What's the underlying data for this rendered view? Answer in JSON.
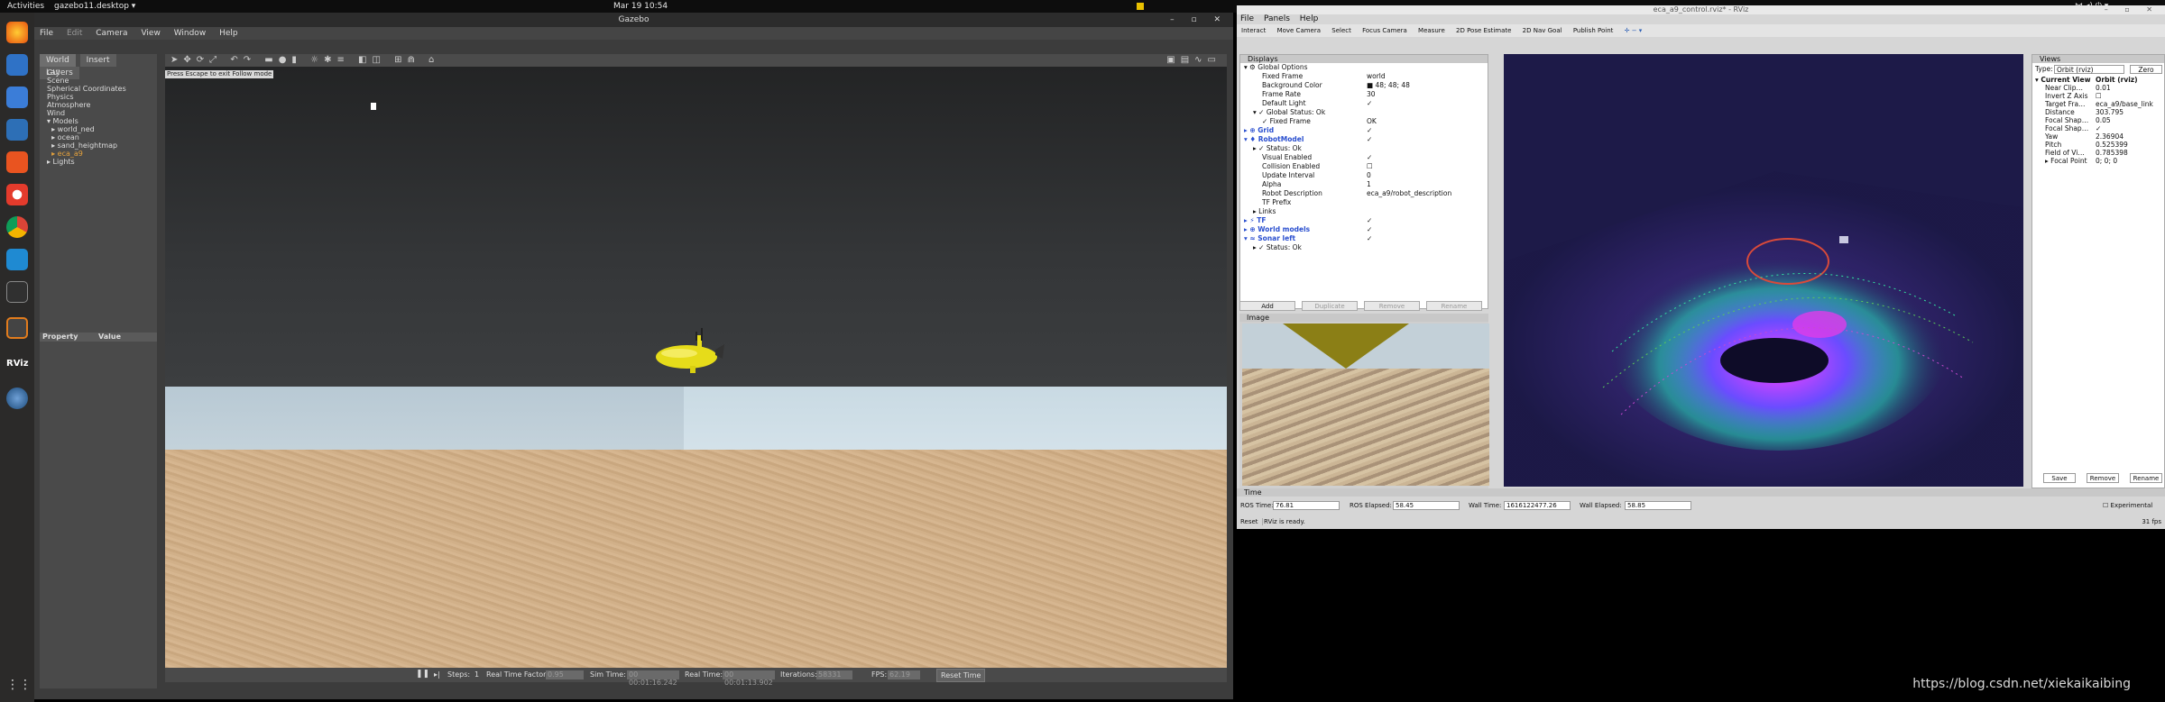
{
  "topbar": {
    "activities": "Activities",
    "app": "gazebo11.desktop ▾",
    "clock": "Mar 19  10:54"
  },
  "dock": {
    "icons": [
      "firefox-icon",
      "thunderbird-icon",
      "files-icon",
      "writer-icon",
      "software-icon",
      "help-icon",
      "chrome-icon",
      "vscode-icon",
      "terminal-icon",
      "gazebo-icon",
      "rviz-icon",
      "globe-icon"
    ],
    "rviz_label": "RViz",
    "apps_grid": "⋮⋮⋮"
  },
  "gazebo": {
    "title": "Gazebo",
    "menu": [
      "File",
      "Edit",
      "Camera",
      "View",
      "Window",
      "Help"
    ],
    "tabs": [
      "World",
      "Insert",
      "Layers"
    ],
    "tree": [
      "GUI",
      "Scene",
      "Spherical Coordinates",
      "Physics",
      "Atmosphere",
      "Wind",
      "▾ Models",
      "  ▸ world_ned",
      "  ▸ ocean",
      "  ▸ sand_heightmap",
      "  ▸ eca_a9",
      "▸ Lights"
    ],
    "property_header": {
      "property": "Property",
      "value": "Value"
    },
    "hint": "Press Escape to exit Follow mode",
    "bottom": {
      "pause": "❚❚",
      "steps_label": "Steps:",
      "steps": "1",
      "rtf_label": "Real Time Factor:",
      "rtf": "0.95",
      "sim_label": "Sim Time:",
      "sim": "00 00:01:16.242",
      "real_label": "Real Time:",
      "real": "00 00:01:13.902",
      "iter_label": "Iterations:",
      "iter": "58331",
      "fps_label": "FPS:",
      "fps": "62.19",
      "reset": "Reset Time"
    }
  },
  "rviz": {
    "title": "eca_a9_control.rviz* - RViz",
    "menu": [
      "File",
      "Panels",
      "Help"
    ],
    "tools": [
      "Interact",
      "Move Camera",
      "Select",
      "Focus Camera",
      "Measure",
      "2D Pose Estimate",
      "2D Nav Goal",
      "Publish Point"
    ],
    "displays_title": "Displays",
    "rows": [
      {
        "k": "▾ ⚙ Global Options",
        "v": "",
        "i": 0,
        "c": ""
      },
      {
        "k": "Fixed Frame",
        "v": "world",
        "i": 2,
        "c": ""
      },
      {
        "k": "Background Color",
        "v": "■ 48; 48; 48",
        "i": 2,
        "c": ""
      },
      {
        "k": "Frame Rate",
        "v": "30",
        "i": 2,
        "c": ""
      },
      {
        "k": "Default Light",
        "v": "✓",
        "i": 2,
        "c": ""
      },
      {
        "k": "▾ ✓ Global Status: Ok",
        "v": "",
        "i": 1,
        "c": ""
      },
      {
        "k": "✓ Fixed Frame",
        "v": "OK",
        "i": 2,
        "c": ""
      },
      {
        "k": "▸ ⊕ Grid",
        "v": "✓",
        "i": 0,
        "c": "blue"
      },
      {
        "k": "▾ ♦ RobotModel",
        "v": "✓",
        "i": 0,
        "c": "blue"
      },
      {
        "k": "▸ ✓ Status: Ok",
        "v": "",
        "i": 1,
        "c": ""
      },
      {
        "k": "Visual Enabled",
        "v": "✓",
        "i": 2,
        "c": ""
      },
      {
        "k": "Collision Enabled",
        "v": "☐",
        "i": 2,
        "c": ""
      },
      {
        "k": "Update Interval",
        "v": "0",
        "i": 2,
        "c": ""
      },
      {
        "k": "Alpha",
        "v": "1",
        "i": 2,
        "c": ""
      },
      {
        "k": "Robot Description",
        "v": "eca_a9/robot_description",
        "i": 2,
        "c": ""
      },
      {
        "k": "TF Prefix",
        "v": "",
        "i": 2,
        "c": ""
      },
      {
        "k": "▸ Links",
        "v": "",
        "i": 1,
        "c": ""
      },
      {
        "k": "▸ ⚡ TF",
        "v": "✓",
        "i": 0,
        "c": "blue"
      },
      {
        "k": "▸ ⊕ World models",
        "v": "✓",
        "i": 0,
        "c": "blue"
      },
      {
        "k": "▾ ≈ Sonar left",
        "v": "✓",
        "i": 0,
        "c": "blue"
      },
      {
        "k": "▸ ✓ Status: Ok",
        "v": "",
        "i": 1,
        "c": ""
      }
    ],
    "disp_buttons": [
      "Add",
      "Duplicate",
      "Remove",
      "Rename"
    ],
    "image_title": "Image",
    "views": {
      "title": "Views",
      "type_label": "Type:",
      "type_value": "Orbit (rviz)",
      "zero": "Zero",
      "rows": [
        {
          "k": "▾ Current View",
          "v": "Orbit (rviz)"
        },
        {
          "k": "Near Clip…",
          "v": "0.01"
        },
        {
          "k": "Invert Z Axis",
          "v": "☐"
        },
        {
          "k": "Target Fra…",
          "v": "eca_a9/base_link"
        },
        {
          "k": "Distance",
          "v": "303.795"
        },
        {
          "k": "Focal Shap…",
          "v": "0.05"
        },
        {
          "k": "Focal Shap…",
          "v": "✓"
        },
        {
          "k": "Yaw",
          "v": "2.36904"
        },
        {
          "k": "Pitch",
          "v": "0.525399"
        },
        {
          "k": "Field of Vi…",
          "v": "0.785398"
        },
        {
          "k": "▸ Focal Point",
          "v": "0; 0; 0"
        }
      ],
      "buttons": [
        "Save",
        "Remove",
        "Rename"
      ]
    },
    "time": {
      "title": "Time",
      "ros_time_label": "ROS Time:",
      "ros_time": "76.81",
      "ros_elapsed_label": "ROS Elapsed:",
      "ros_elapsed": "58.45",
      "wall_time_label": "Wall Time:",
      "wall_time": "1616122477.26",
      "wall_elapsed_label": "Wall Elapsed:",
      "wall_elapsed": "58.85",
      "experimental": "Experimental",
      "reset": "Reset",
      "status": "RViz is ready.",
      "fps": "31 fps"
    }
  },
  "watermark": "https://blog.csdn.net/xiekaikaibing"
}
